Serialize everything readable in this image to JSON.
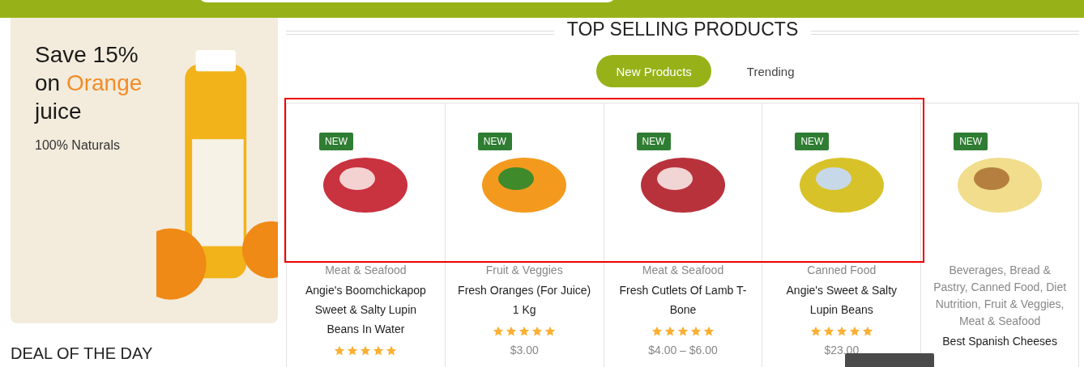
{
  "banner": {
    "headline_before": "Save 15% on",
    "headline_highlight": "Orange",
    "headline_after": "juice",
    "subtitle": "100% Naturals"
  },
  "section": {
    "title": "TOP SELLING PRODUCTS",
    "tabs": [
      {
        "label": "New Products",
        "selected": true
      },
      {
        "label": "Trending",
        "selected": false
      }
    ],
    "products": [
      {
        "badge": "NEW",
        "category": "Meat & Seafood",
        "name": "Angie's Boomchickapop Sweet & Salty Lupin Beans In Water",
        "stars": 5
      },
      {
        "badge": "NEW",
        "category": "Fruit & Veggies",
        "name": "Fresh Oranges (For Juice) 1 Kg",
        "stars": 5,
        "price": "$3.00"
      },
      {
        "badge": "NEW",
        "category": "Meat & Seafood",
        "name": "Fresh Cutlets Of Lamb T-Bone",
        "stars": 5,
        "price": "$4.00 – $6.00"
      },
      {
        "badge": "NEW",
        "category": "Canned Food",
        "name": "Angie's Sweet & Salty Lupin Beans",
        "stars": 5,
        "price": "$23.00"
      },
      {
        "badge": "NEW",
        "category": "Beverages, Bread & Pastry, Canned Food, Diet Nutrition, Fruit & Veggies, Meat & Seafood",
        "name": "Best Spanish Cheeses"
      }
    ]
  },
  "deal_heading": "DEAL OF THE DAY"
}
